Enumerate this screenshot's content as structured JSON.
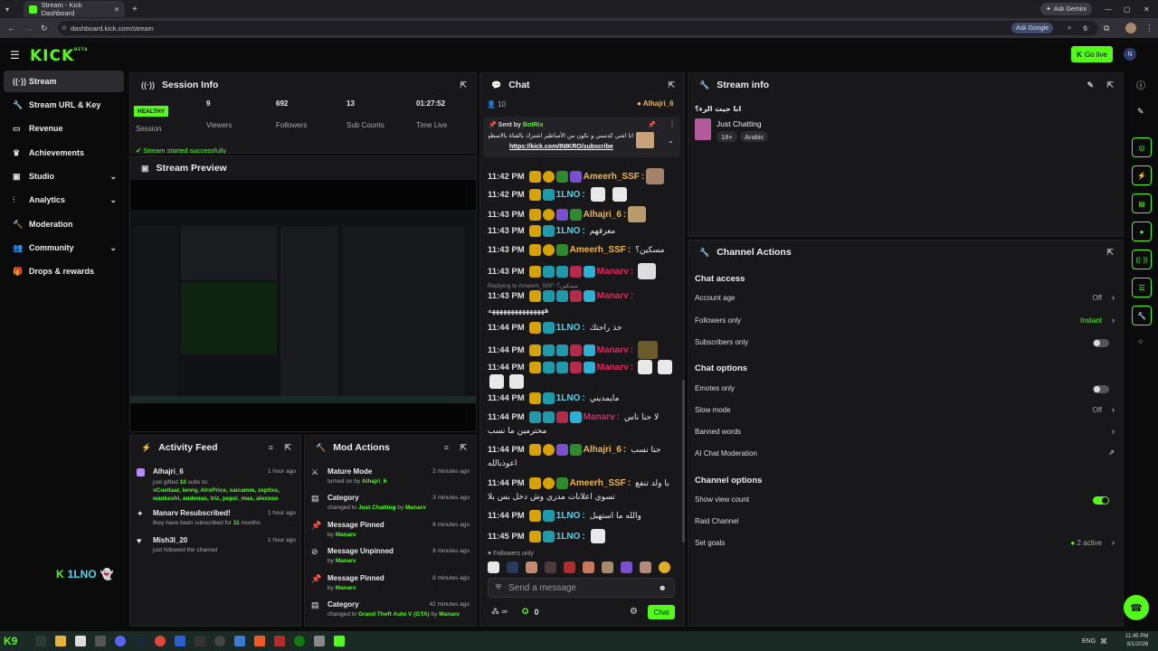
{
  "browser": {
    "tab_title": "Stream - Kick Dashboard",
    "url": "dashboard.kick.com/stream",
    "ask_gemini": "Ask Gemini",
    "ask_google": "Ask Google"
  },
  "topnav": {
    "logo": "KICK",
    "logo_sup": "BETA",
    "go_live": "Go live"
  },
  "sidebar": {
    "items": [
      {
        "label": "Stream",
        "icon": "broadcast-icon"
      },
      {
        "label": "Stream URL & Key",
        "icon": "wrench-icon"
      },
      {
        "label": "Revenue",
        "icon": "money-icon"
      },
      {
        "label": "Achievements",
        "icon": "trophy-icon"
      },
      {
        "label": "Studio",
        "icon": "box-icon"
      },
      {
        "label": "Analytics",
        "icon": "chart-icon"
      },
      {
        "label": "Moderation",
        "icon": "wrench-icon"
      },
      {
        "label": "Community",
        "icon": "users-icon"
      },
      {
        "label": "Drops & rewards",
        "icon": "gift-icon"
      }
    ],
    "user_badge": "1LNO"
  },
  "session": {
    "title": "Session Info",
    "status": "HEALTHY",
    "session_label": "Session",
    "viewers": "9",
    "viewers_label": "Viewers",
    "followers": "692",
    "followers_label": "Followers",
    "subs": "13",
    "subs_label": "Sub Counts",
    "time": "01:27:52",
    "time_label": "Time Live",
    "toast": "Stream started successfully"
  },
  "preview": {
    "title": "Stream Preview"
  },
  "activity": {
    "title": "Activity Feed",
    "items": [
      {
        "title": "Alhajri_6",
        "time": "1 hour ago",
        "line1": "just gifted",
        "count": "10",
        "line1b": "subs to:",
        "names": "vCuellaar, lenny, AlrxPrice, saicamm, zeptixs, wankeshi, andonus, triz, pepsi_max, alexxoo"
      },
      {
        "title": "Manarv Resubscribed!",
        "time": "1 hour ago",
        "sub": "they have been subscribed for",
        "months": "11",
        "sub2": "months"
      },
      {
        "title": "Mish3l_20",
        "time": "1 hour ago",
        "sub": "just followed the channel"
      }
    ]
  },
  "mod": {
    "title": "Mod Actions",
    "items": [
      {
        "title": "Mature Mode",
        "time": "2 minutes ago",
        "pre": "turned on by",
        "who": "Alhajri_6"
      },
      {
        "title": "Category",
        "time": "3 minutes ago",
        "pre": "changed to",
        "what": "Just Chatting",
        "mid": "by",
        "who": "Manarv"
      },
      {
        "title": "Message Pinned",
        "time": "8 minutes ago",
        "pre": "by",
        "who": "Manarv"
      },
      {
        "title": "Message Unpinned",
        "time": "8 minutes ago",
        "pre": "by",
        "who": "Manarv"
      },
      {
        "title": "Message Pinned",
        "time": "8 minutes ago",
        "pre": "by",
        "who": "Manarv"
      },
      {
        "title": "Category",
        "time": "42 minutes ago",
        "pre": "changed to",
        "what": "Grand Theft Auto V (GTA)",
        "mid": "by",
        "who": "Manarv"
      }
    ]
  },
  "chat": {
    "title": "Chat",
    "count": "10",
    "top_user": "Alhajri_6",
    "pinned": {
      "sent_by": "Sent by",
      "bot": "BotRix",
      "text": "انا اشي كدسني و نكون من الأساطير اشترك بالقناة بالاسطوري",
      "link": "https://kick.com/INIKRO/subscribe"
    },
    "lines": [
      {
        "time": "11:42 PM",
        "user": "Ameerh_SSF",
        "cls": "u-or",
        "msg": ""
      },
      {
        "time": "11:42 PM",
        "user": "1LNO",
        "cls": "u-cy",
        "msg": ""
      },
      {
        "time": "11:43 PM",
        "user": "Alhajri_6",
        "cls": "u-or",
        "msg": ""
      },
      {
        "time": "11:43 PM",
        "user": "1LNO",
        "cls": "u-cy",
        "msg": "معرفهم"
      },
      {
        "time": "11:43 PM",
        "user": "Ameerh_SSF",
        "cls": "u-or",
        "msg": "مسكين؟"
      },
      {
        "time": "11:43 PM",
        "user": "Manarv",
        "cls": "u-rd",
        "msg": ""
      },
      {
        "time": "11:43 PM",
        "user": "Manarv",
        "cls": "u-rd",
        "msg": ""
      },
      {
        "time": "11:44 PM",
        "user": "1LNO",
        "cls": "u-cy",
        "msg": "خذ راحتك"
      },
      {
        "time": "11:44 PM",
        "user": "Manarv",
        "cls": "u-rd",
        "msg": ""
      },
      {
        "time": "11:44 PM",
        "user": "Manarv",
        "cls": "u-rd",
        "msg": ""
      },
      {
        "time": "11:44 PM",
        "user": "1LNO",
        "cls": "u-cy",
        "msg": "مايمديني"
      },
      {
        "time": "11:44 PM",
        "user": "Manarv",
        "cls": "u-rd",
        "msg": "لا حنا ناس"
      },
      {
        "time": "11:44 PM",
        "user": "Alhajri_6",
        "cls": "u-or",
        "msg": "حنا نسب"
      },
      {
        "time": "11:44 PM",
        "user": "Ameerh_SSF",
        "cls": "u-or",
        "msg": "يا ولد تنفع"
      },
      {
        "time": "11:44 PM",
        "user": "1LNO",
        "cls": "u-cy",
        "msg": "والله ما استهبل"
      },
      {
        "time": "11:45 PM",
        "user": "1LNO",
        "cls": "u-cy",
        "msg": ""
      }
    ],
    "reply_note": "Replying to Ameerh_SSF: مسكين؟",
    "manarv_long": "هههههههههههههههه",
    "wrap1": "محترمين ما نسب",
    "wrap2": "اعوذبالله",
    "wrap3": "تسوي اعلانات مدري وش دخل بس بلا",
    "followers_only": "Followers only",
    "placeholder": "Send a message",
    "points": "0",
    "send": "Chat"
  },
  "stream_info": {
    "title": "Stream info",
    "stream_title": "انا جيت الرء؟",
    "category": "Just Chatting",
    "tags": [
      "18+",
      "Arabic"
    ]
  },
  "channel_actions": {
    "title": "Channel Actions",
    "chat_access": "Chat access",
    "account_age": "Account age",
    "account_age_val": "Off",
    "followers_only": "Followers only",
    "followers_only_val": "Instant",
    "subs_only": "Subscribers only",
    "chat_options": "Chat options",
    "emotes_only": "Emotes only",
    "slow_mode": "Slow mode",
    "slow_mode_val": "Off",
    "banned_words": "Banned words",
    "ai_mod": "AI Chat Moderation",
    "channel_options": "Channel options",
    "show_view": "Show view count",
    "raid": "Raid Channel",
    "goals": "Set goals",
    "goals_val": "2 active"
  },
  "taskbar": {
    "lang": "ENG",
    "time": "11:45 PM",
    "date": "8/1/2026"
  },
  "colors": {
    "accent": "#53fc18",
    "bg": "#0b0b0c",
    "panel": "#18181b"
  }
}
